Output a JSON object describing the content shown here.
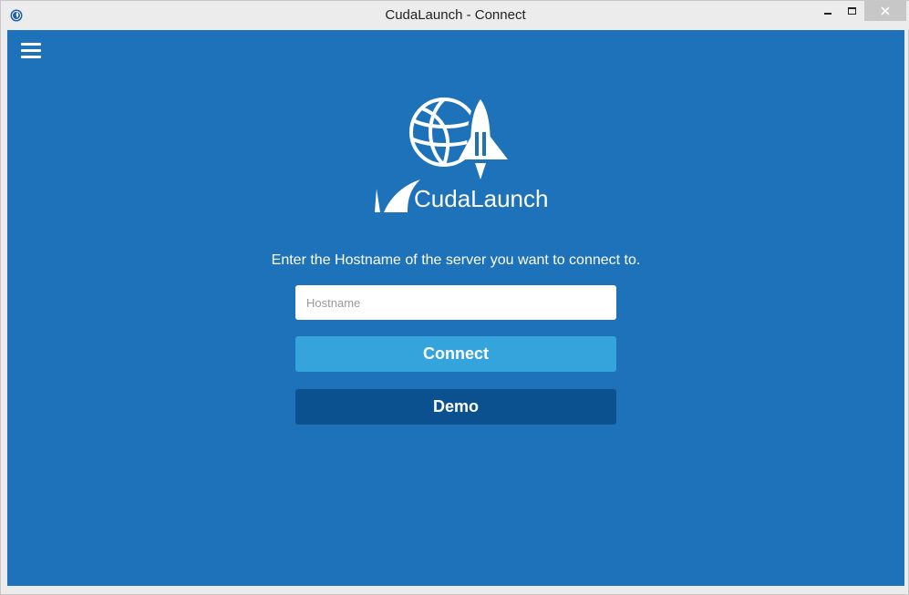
{
  "window": {
    "title": "CudaLaunch - Connect",
    "icon": "cudalaunch-app-icon",
    "controls": [
      "minimize-icon",
      "maximize-icon",
      "close-icon"
    ]
  },
  "theme": {
    "background": "#1e72ba",
    "connect_button": "#35a4dd",
    "demo_button": "#0b518f",
    "text": "#ffffff"
  },
  "menu": {
    "icon": "hamburger-menu-icon"
  },
  "logo": {
    "text": "CudaLaunch",
    "icon": "globe-rocket-logo"
  },
  "connect_form": {
    "prompt": "Enter the Hostname of the server you want to connect to.",
    "hostname": {
      "value": "",
      "placeholder": "Hostname"
    },
    "connect_label": "Connect",
    "demo_label": "Demo"
  }
}
